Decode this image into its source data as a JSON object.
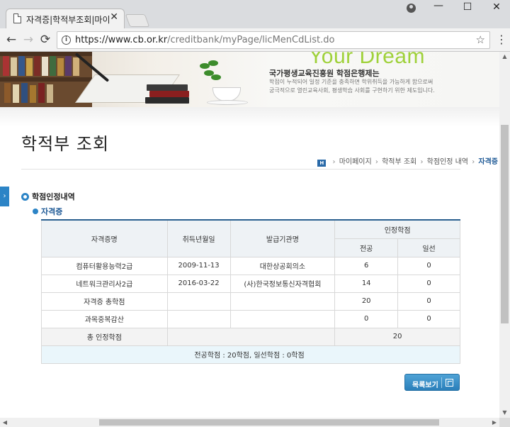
{
  "browser": {
    "tab_title": "자격증|학적부조회|마이페",
    "url_host": "https://www.cb.or.kr",
    "url_path": "/creditbank/myPage/licMenCdList.do"
  },
  "banner": {
    "slogan": "Your Dream",
    "title": "국가평생교육진흥원 학점은행제는",
    "desc_line1": "학점이 누적되어 일정 기준을 충족하면 학위취득을 가능하게 함으로써",
    "desc_line2": "궁극적으로 열린교육사회, 평생학습 사회를 구현하기 위한 제도입니다."
  },
  "page": {
    "title": "학적부 조회",
    "breadcrumb": [
      "마이페이지",
      "학적부 조회",
      "학점인정 내역",
      "자격증"
    ],
    "home_icon_text": "H",
    "section_title": "학점인정내역",
    "subsection_title": "자격증"
  },
  "table": {
    "headers": {
      "cert_name": "자격증명",
      "acquired_date": "취득년월일",
      "issuer": "발급기관명",
      "recognized": "인정학점",
      "major": "전공",
      "general": "일선"
    },
    "rows": [
      {
        "name": "컴퓨터활용능력2급",
        "date": "2009-11-13",
        "issuer": "대한상공회의소",
        "major": "6",
        "general": "0"
      },
      {
        "name": "네트워크관리사2급",
        "date": "2016-03-22",
        "issuer": "(사)한국정보통신자격협회",
        "major": "14",
        "general": "0"
      },
      {
        "name": "자격증 총학점",
        "date": "",
        "issuer": "",
        "major": "20",
        "general": "0"
      },
      {
        "name": "과목중복감산",
        "date": "",
        "issuer": "",
        "major": "0",
        "general": "0"
      }
    ],
    "total_label": "총 인정학점",
    "total_value": "20",
    "summary": "전공학점 : 20학점, 일선학점 : 0학점"
  },
  "buttons": {
    "list_label": "목록보기"
  }
}
